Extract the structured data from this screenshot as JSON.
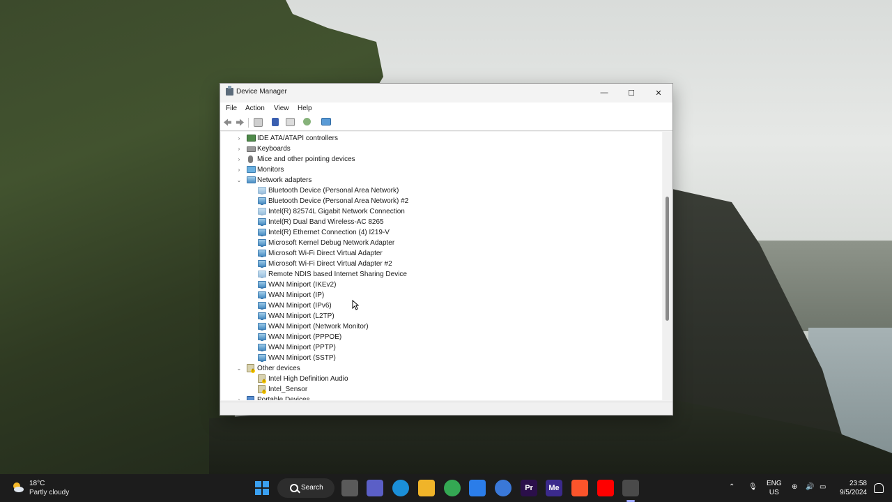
{
  "window": {
    "title": "Device Manager",
    "controls": {
      "minimize": "—",
      "maximize": "☐",
      "close": "✕"
    }
  },
  "menu": {
    "file": "File",
    "action": "Action",
    "view": "View",
    "help": "Help"
  },
  "toolbar_icons": [
    "back-arrow-icon",
    "forward-arrow-icon",
    "properties-icon",
    "help-icon",
    "view-icon",
    "update-driver-icon",
    "scan-hardware-icon"
  ],
  "tree": {
    "categories": {
      "ide": "IDE ATA/ATAPI controllers",
      "keyboards": "Keyboards",
      "mice": "Mice and other pointing devices",
      "monitors": "Monitors",
      "network": "Network adapters",
      "other": "Other devices",
      "portable": "Portable Devices"
    },
    "network_adapters": [
      "Bluetooth Device (Personal Area Network)",
      "Bluetooth Device (Personal Area Network) #2",
      "Intel(R) 82574L Gigabit Network Connection",
      "Intel(R) Dual Band Wireless-AC 8265",
      "Intel(R) Ethernet Connection (4) I219-V",
      "Microsoft Kernel Debug Network Adapter",
      "Microsoft Wi-Fi Direct Virtual Adapter",
      "Microsoft Wi-Fi Direct Virtual Adapter #2",
      "Remote NDIS based Internet Sharing Device",
      "WAN Miniport (IKEv2)",
      "WAN Miniport (IP)",
      "WAN Miniport (IPv6)",
      "WAN Miniport (L2TP)",
      "WAN Miniport (Network Monitor)",
      "WAN Miniport (PPPOE)",
      "WAN Miniport (PPTP)",
      "WAN Miniport (SSTP)"
    ],
    "other_devices": [
      "Intel High Definition Audio",
      "Intel_Sensor"
    ]
  },
  "taskbar": {
    "weather": {
      "temp": "18°C",
      "desc": "Partly cloudy"
    },
    "search": "Search",
    "apps": [
      {
        "name": "file-explorer",
        "label": "",
        "color": "#f0b429"
      },
      {
        "name": "chrome",
        "label": "",
        "color": "#34a853"
      },
      {
        "name": "store",
        "label": "",
        "color": "#2b7de9"
      },
      {
        "name": "premiere",
        "label": "Pr",
        "color": "#2b0f4a"
      },
      {
        "name": "media-encoder",
        "label": "Me",
        "color": "#3b2a8c"
      },
      {
        "name": "brave",
        "label": "",
        "color": "#fb542b"
      },
      {
        "name": "youtube",
        "label": "",
        "color": "#ff0000"
      }
    ],
    "lang": {
      "line1": "ENG",
      "line2": "US"
    },
    "clock": {
      "time": "23:58",
      "date": "9/5/2024"
    }
  }
}
